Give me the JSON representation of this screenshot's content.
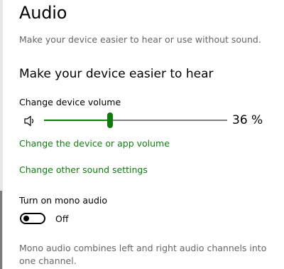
{
  "page": {
    "title": "Audio",
    "subtitle": "Make your device easier to hear or use without sound."
  },
  "hearing_section": {
    "heading": "Make your device easier to hear",
    "volume": {
      "label": "Change device volume",
      "icon": "speaker-icon",
      "value": 36,
      "value_text": "36 %",
      "accent_color": "#107c10"
    },
    "links": [
      "Change the device or app volume",
      "Change other sound settings"
    ]
  },
  "mono_audio": {
    "label": "Turn on mono audio",
    "toggle_on": false,
    "state_text": "Off",
    "description": "Mono audio combines left and right audio channels into one channel."
  }
}
